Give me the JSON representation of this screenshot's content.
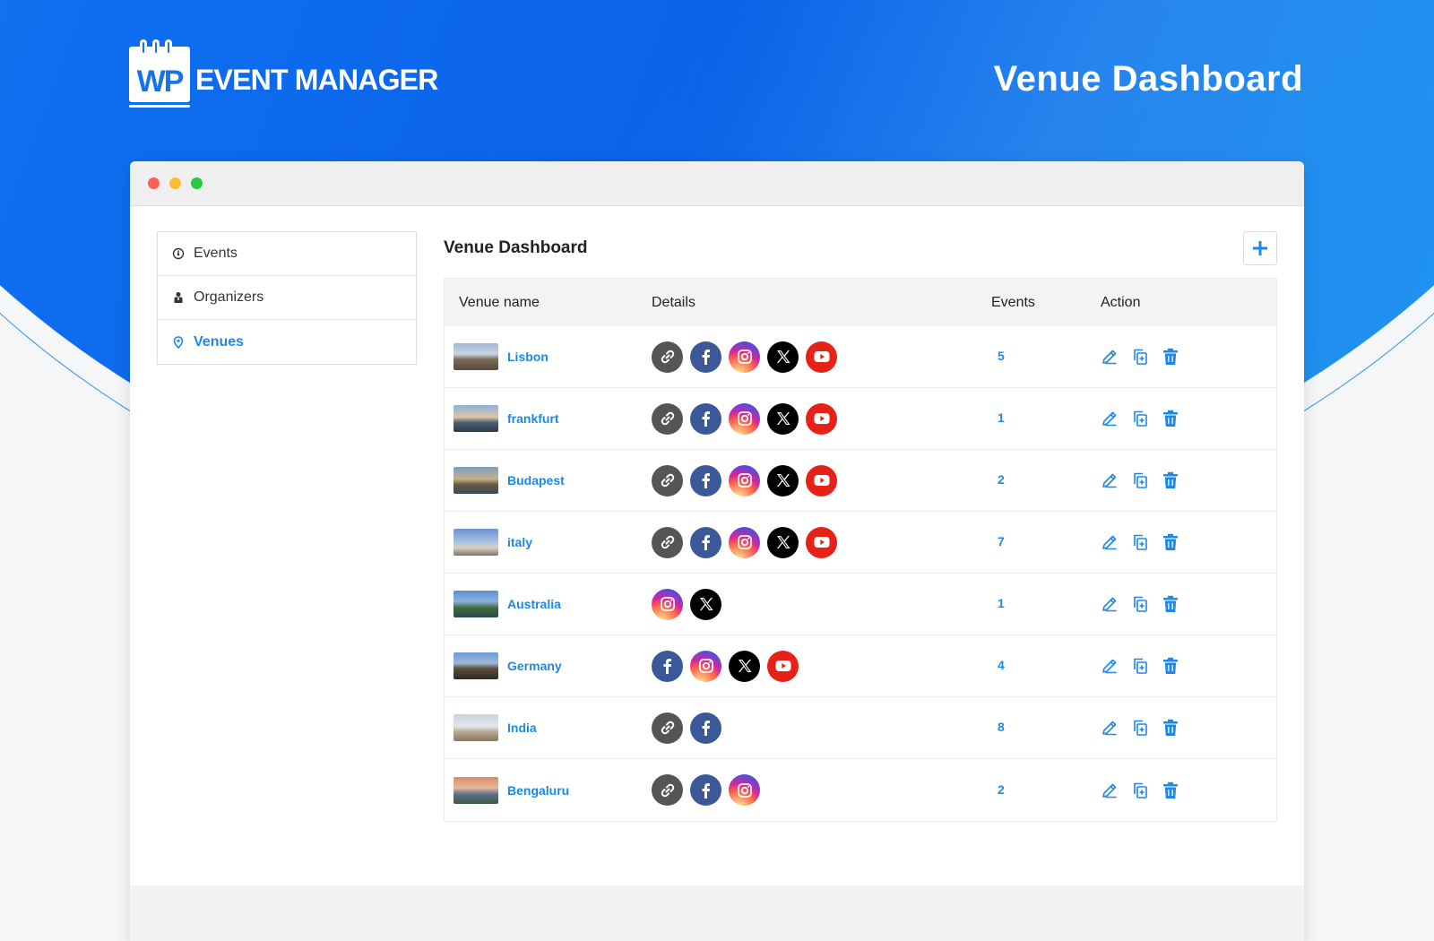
{
  "brand": {
    "logo_mark": "WP",
    "name": "EVENT MANAGER"
  },
  "hero": {
    "title": "Venue Dashboard"
  },
  "window": {
    "controls": [
      "close",
      "minimize",
      "maximize"
    ]
  },
  "sidebar": {
    "items": [
      {
        "label": "Events",
        "icon": "dashboard-icon",
        "active": false
      },
      {
        "label": "Organizers",
        "icon": "organizer-icon",
        "active": false
      },
      {
        "label": "Venues",
        "icon": "location-pin-icon",
        "active": true
      }
    ]
  },
  "main": {
    "title": "Venue Dashboard",
    "add_button": "plus-icon",
    "columns": {
      "name": "Venue name",
      "details": "Details",
      "events": "Events",
      "action": "Action"
    },
    "venues": [
      {
        "name": "Lisbon",
        "socials": [
          "link",
          "facebook",
          "instagram",
          "x",
          "youtube"
        ],
        "events": "5"
      },
      {
        "name": "frankfurt",
        "socials": [
          "link",
          "facebook",
          "instagram",
          "x",
          "youtube"
        ],
        "events": "1"
      },
      {
        "name": "Budapest",
        "socials": [
          "link",
          "facebook",
          "instagram",
          "x",
          "youtube"
        ],
        "events": "2"
      },
      {
        "name": "italy",
        "socials": [
          "link",
          "facebook",
          "instagram",
          "x",
          "youtube"
        ],
        "events": "7"
      },
      {
        "name": "Australia",
        "socials": [
          "instagram",
          "x"
        ],
        "events": "1"
      },
      {
        "name": "Germany",
        "socials": [
          "facebook",
          "instagram",
          "x",
          "youtube"
        ],
        "events": "4"
      },
      {
        "name": "India",
        "socials": [
          "link",
          "facebook"
        ],
        "events": "8"
      },
      {
        "name": "Bengaluru",
        "socials": [
          "link",
          "facebook",
          "instagram"
        ],
        "events": "2"
      }
    ],
    "row_actions": [
      "edit-icon",
      "duplicate-icon",
      "delete-icon"
    ]
  },
  "colors": {
    "accent": "#1e88e5",
    "hero_blue": "#0a62e8",
    "link": "#555555",
    "facebook": "#3b5998",
    "x": "#000000",
    "youtube": "#e62117"
  }
}
